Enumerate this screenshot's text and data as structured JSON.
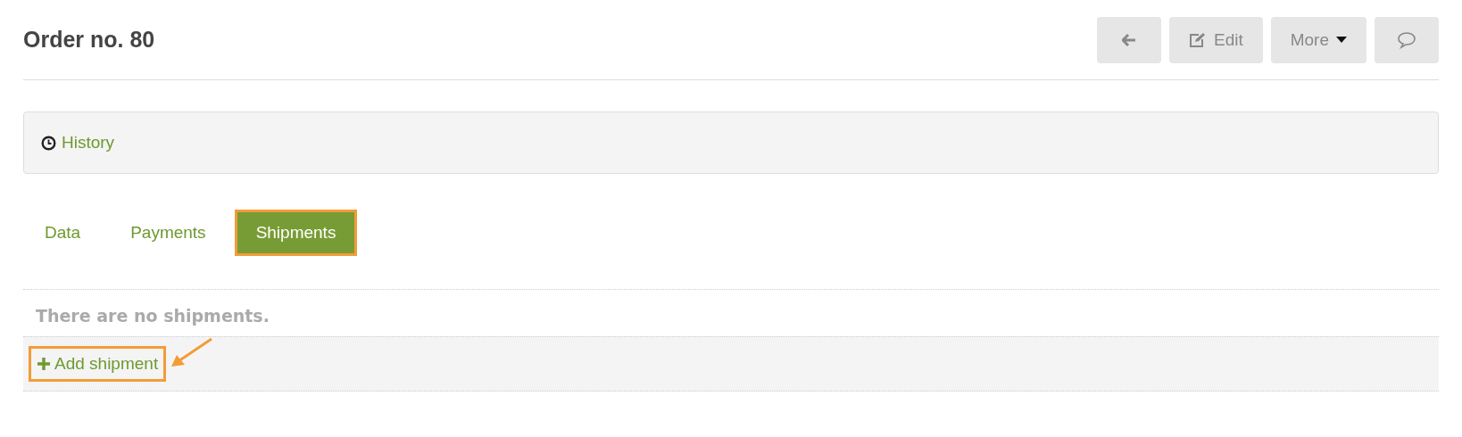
{
  "title": "Order no. 80",
  "toolbar": [
    {
      "kind": "back"
    },
    {
      "kind": "edit",
      "label": "Edit"
    },
    {
      "kind": "more",
      "label": "More"
    },
    {
      "kind": "comment"
    }
  ],
  "history_link": "History",
  "tabs": [
    {
      "label": "Data",
      "selected": false,
      "highlighted": false
    },
    {
      "label": "Payments",
      "selected": false,
      "highlighted": false
    },
    {
      "label": "Shipments",
      "selected": true,
      "highlighted": true
    }
  ],
  "empty_message": "There are no shipments.",
  "add_shipment": {
    "label": "Add shipment",
    "highlighted": true
  }
}
